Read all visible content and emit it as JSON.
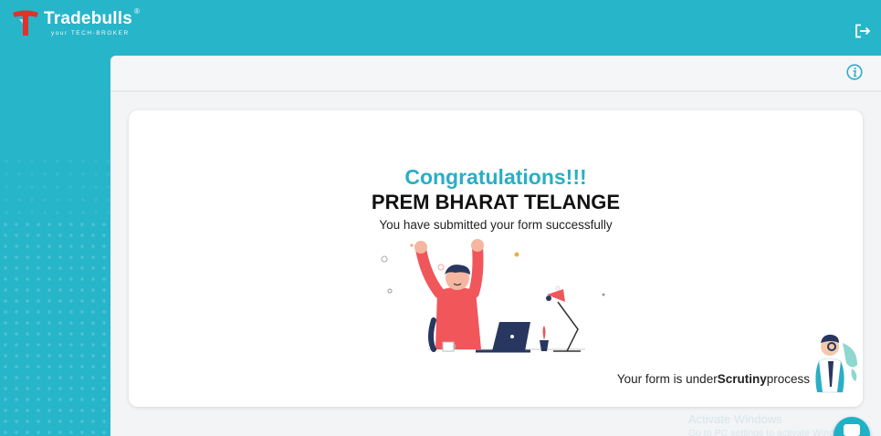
{
  "brand": {
    "name": "Tradebulls",
    "registered": "®",
    "tagline": "your TECH-BROKER"
  },
  "header": {
    "logout_icon": "logout-icon",
    "info_icon": "info-icon"
  },
  "success": {
    "heading": "Congratulations!!!",
    "applicant_name": "PREM BHARAT TELANGE",
    "message": "You have submitted your form successfully",
    "status_prefix": "Your form is under",
    "status_emphasis": "Scrutiny",
    "status_suffix": "process"
  },
  "windows_watermark": {
    "title": "Activate Windows",
    "subtitle": "Go to PC settings to activate Windows."
  },
  "colors": {
    "background": "#27b5ca",
    "accent": "#2aaec4",
    "brand_red": "#e0312b"
  }
}
